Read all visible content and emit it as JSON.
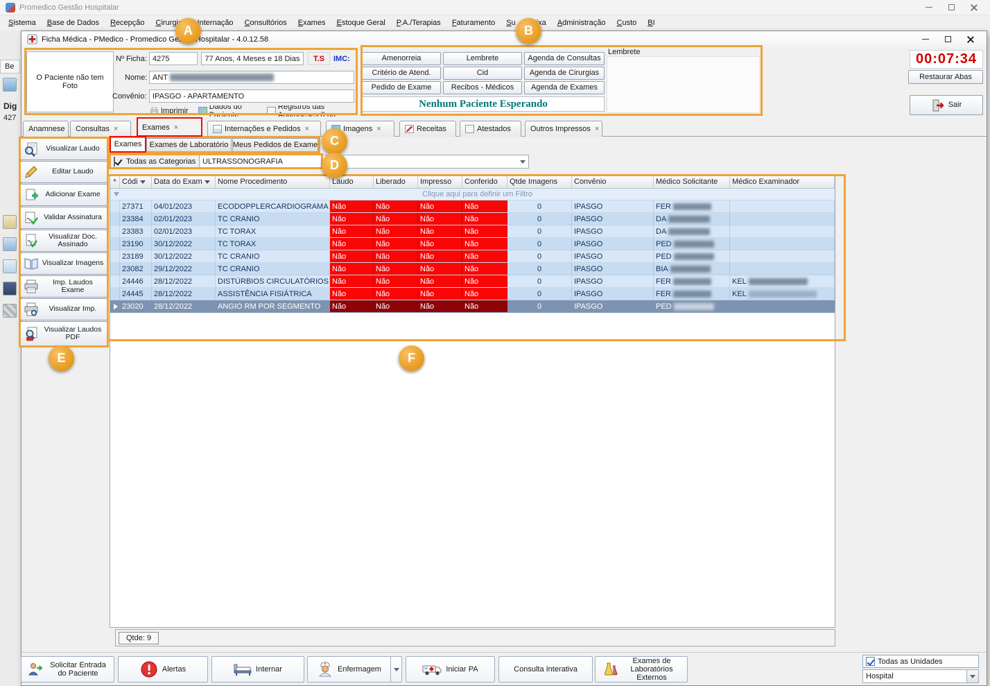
{
  "colors": {
    "annotation_orange": "#eea437",
    "highlight_red": "#f30c0c",
    "nao_cell_red": "#f90606",
    "nao_cell_dark_red": "#8e0406",
    "timer_red": "#d40000",
    "waiting_teal": "#007878",
    "selection_blue": "#7e93b1"
  },
  "annotations": {
    "a": "A",
    "b": "B",
    "c": "C",
    "d": "D",
    "e": "E",
    "f": "F"
  },
  "app": {
    "title": "Promedico Gestão Hospitalar",
    "menu": [
      "Sistema",
      "Base de Dados",
      "Recepção",
      "Cirurgias",
      "Internação",
      "Consultórios",
      "Exames",
      "Estoque Geral",
      "P.A./Terapias",
      "Faturamento",
      "Su",
      "Caixa",
      "Administração",
      "Custo",
      "BI"
    ]
  },
  "background_fragments": {
    "f1": "Be",
    "f2": "Dig",
    "f3": "427"
  },
  "window": {
    "title": "Ficha Médica - PMedico - Promedico Gestão Hospitalar - 4.0.12.58"
  },
  "patient": {
    "no_photo_text": "O Paciente não tem Foto",
    "ficha_label": "Nº Ficha:",
    "ficha_number": "4275",
    "age_text": "77 Anos, 4 Meses e 18 Dias",
    "ts_label": "T.S",
    "imc_label": "IMC:",
    "name_label": "Nome:",
    "name_prefix": "ANT",
    "convenio_label": "Convênio:",
    "convenio_value": "IPASGO - APARTAMENTO",
    "action_imprimir": "Imprimir",
    "action_dados": "Dados do Paciente",
    "action_registros": "Registros das Anamneses (Log"
  },
  "quick_panel": {
    "buttons": [
      "Amenorreia",
      "Lembrete",
      "Agenda de Consultas",
      "Critério de Atend.",
      "Cid",
      "Agenda de Cirurgias",
      "Pedido de Exame",
      "Recibos - Médicos",
      "Agenda de Exames"
    ],
    "waiting_text": "Nenhum Paciente Esperando",
    "lembrete_label": "Lembrete"
  },
  "session": {
    "timer": "00:07:34",
    "restore_tabs": "Restaurar Abas",
    "exit": "Sair"
  },
  "tabs": [
    {
      "label": "Anamnese",
      "close": ""
    },
    {
      "label": "Consultas",
      "close": "×"
    },
    {
      "label": "Exames",
      "close": "×"
    },
    {
      "label": "Internações e Pedidos",
      "close": "×"
    },
    {
      "label": "Imagens",
      "close": "×"
    },
    {
      "label": "Receitas",
      "close": ""
    },
    {
      "label": "Atestados",
      "close": ""
    },
    {
      "label": "Outros Impressos",
      "close": "×"
    }
  ],
  "subtabs": [
    "Exames",
    "Exames de Laboratório",
    "Meus Pedidos de Exame"
  ],
  "filter": {
    "all_categories": "Todas as Categorias",
    "category": "ULTRASSONOGRAFIA"
  },
  "exam_toolbar": [
    {
      "label": "Visualizar Laudo",
      "icon": "view-report-icon"
    },
    {
      "label": "Editar Laudo",
      "icon": "edit-report-icon"
    },
    {
      "label": "Adicionar Exame",
      "icon": "add-exam-icon"
    },
    {
      "label": "Validar Assinatura",
      "icon": "validate-signature-icon"
    },
    {
      "label": "Visualizar Doc. Assinado",
      "icon": "view-signed-doc-icon"
    },
    {
      "label": "Visualizar Imagens",
      "icon": "view-images-icon"
    },
    {
      "label": "Imp. Laudos Exame",
      "icon": "print-reports-icon"
    },
    {
      "label": "Visualizar Imp.",
      "icon": "print-preview-icon"
    },
    {
      "label": "Visualizar Laudos PDF",
      "icon": "view-pdf-icon"
    }
  ],
  "grid": {
    "header_marker": "*",
    "filter_hint": "Clique aqui para definir um Filtro",
    "count_label": "Qtde: 9",
    "columns": {
      "codigo": "Códi",
      "data": "Data do Exam",
      "nome": "Nome Procedimento",
      "laudo": "Laudo",
      "liberado": "Liberado",
      "impresso": "Impresso",
      "conferido": "Conferido",
      "qtde": "Qtde Imagens",
      "convenio": "Convênio",
      "solicitante": "Médico Solicitante",
      "examinador": "Médico Examinador"
    },
    "rows": [
      {
        "codigo": "27371",
        "data": "04/01/2023",
        "nome": "ECODOPPLERCARDIOGRAMA",
        "laudo": "Não",
        "liberado": "Não",
        "impresso": "Não",
        "conferido": "Não",
        "qtde": "0",
        "convenio": "IPASGO",
        "solicitante": "FER",
        "examinador": ""
      },
      {
        "codigo": "23384",
        "data": "02/01/2023",
        "nome": "TC CRANIO",
        "laudo": "Não",
        "liberado": "Não",
        "impresso": "Não",
        "conferido": "Não",
        "qtde": "0",
        "convenio": "IPASGO",
        "solicitante": "DA",
        "examinador": ""
      },
      {
        "codigo": "23383",
        "data": "02/01/2023",
        "nome": "TC TORAX",
        "laudo": "Não",
        "liberado": "Não",
        "impresso": "Não",
        "conferido": "Não",
        "qtde": "0",
        "convenio": "IPASGO",
        "solicitante": "DA",
        "examinador": ""
      },
      {
        "codigo": "23190",
        "data": "30/12/2022",
        "nome": "TC TORAX",
        "laudo": "Não",
        "liberado": "Não",
        "impresso": "Não",
        "conferido": "Não",
        "qtde": "0",
        "convenio": "IPASGO",
        "solicitante": "PED",
        "examinador": ""
      },
      {
        "codigo": "23189",
        "data": "30/12/2022",
        "nome": "TC CRANIO",
        "laudo": "Não",
        "liberado": "Não",
        "impresso": "Não",
        "conferido": "Não",
        "qtde": "0",
        "convenio": "IPASGO",
        "solicitante": "PED",
        "examinador": ""
      },
      {
        "codigo": "23082",
        "data": "29/12/2022",
        "nome": "TC CRANIO",
        "laudo": "Não",
        "liberado": "Não",
        "impresso": "Não",
        "conferido": "Não",
        "qtde": "0",
        "convenio": "IPASGO",
        "solicitante": "BIA",
        "examinador": ""
      },
      {
        "codigo": "24446",
        "data": "28/12/2022",
        "nome": "DISTÚRBIOS CIRCULATÓRIOS",
        "laudo": "Não",
        "liberado": "Não",
        "impresso": "Não",
        "conferido": "Não",
        "qtde": "0",
        "convenio": "IPASGO",
        "solicitante": "FER",
        "examinador": "KEL"
      },
      {
        "codigo": "24445",
        "data": "28/12/2022",
        "nome": "ASSISTÊNCIA FISIÁTRICA",
        "laudo": "Não",
        "liberado": "Não",
        "impresso": "Não",
        "conferido": "Não",
        "qtde": "0",
        "convenio": "IPASGO",
        "solicitante": "FER",
        "examinador": "KEL"
      },
      {
        "codigo": "23020",
        "data": "28/12/2022",
        "nome": "ANGIO RM POR SEGMENTO",
        "laudo": "Não",
        "liberado": "Não",
        "impresso": "Não",
        "conferido": "Não",
        "qtde": "0",
        "convenio": "IPASGO",
        "solicitante": "PED",
        "examinador": ""
      }
    ]
  },
  "bottom_toolbar": {
    "solicitar": "Solicitar Entrada do Paciente",
    "alertas": "Alertas",
    "internar": "Internar",
    "enfermagem": "Enfermagem",
    "iniciar_pa": "Iniciar PA",
    "consulta": "Consulta Interativa",
    "exames_ext": "Exames de Laboratórios Externos"
  },
  "units": {
    "todas": "Todas as Unidades",
    "selected": "Hospital"
  }
}
